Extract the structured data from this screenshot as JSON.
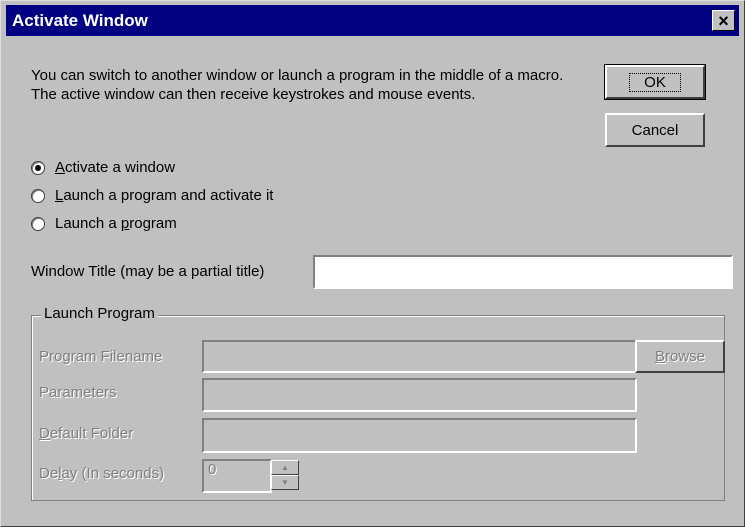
{
  "window": {
    "title": "Activate Window",
    "close_label": "×"
  },
  "description": "You can switch to another window or launch a program in the middle of a macro.  The active window can then receive keystrokes and mouse events.",
  "buttons": {
    "ok": "OK",
    "cancel": "Cancel"
  },
  "radios": [
    {
      "first": "A",
      "rest": "ctivate a window",
      "checked": true
    },
    {
      "first": "L",
      "rest": "aunch a program and activate it",
      "checked": false
    },
    {
      "pre": "Launch a ",
      "first": "p",
      "rest": "rogram",
      "checked": false
    }
  ],
  "window_title": {
    "label": "Window Title (may be a partial title)",
    "value": ""
  },
  "launch_group": {
    "label": "Launch Program",
    "program_filename_label": "Program Filename",
    "browse_first": "B",
    "browse_rest": "rowse",
    "parameters_label": "Parameters",
    "default_folder_first": "D",
    "default_folder_rest": "efault Folder",
    "delay_pre": "De",
    "delay_u": "l",
    "delay_rest": "ay (In seconds)",
    "delay_value": "0"
  }
}
